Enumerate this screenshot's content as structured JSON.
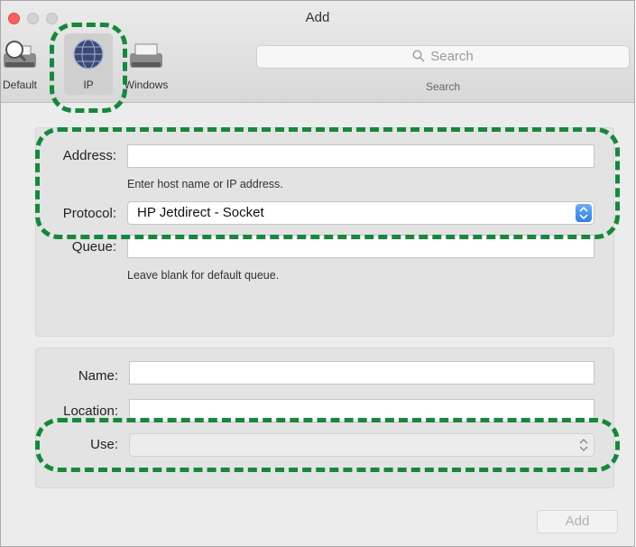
{
  "window": {
    "title": "Add"
  },
  "toolbar": {
    "items": [
      {
        "label": "Default"
      },
      {
        "label": "IP"
      },
      {
        "label": "Windows"
      }
    ],
    "search": {
      "placeholder": "Search",
      "label": "Search"
    }
  },
  "form": {
    "address": {
      "label": "Address:",
      "value": "",
      "hint": "Enter host name or IP address."
    },
    "protocol": {
      "label": "Protocol:",
      "value": "HP Jetdirect - Socket"
    },
    "queue": {
      "label": "Queue:",
      "value": "",
      "hint": "Leave blank for default queue."
    },
    "name": {
      "label": "Name:",
      "value": ""
    },
    "location": {
      "label": "Location:",
      "value": ""
    },
    "use": {
      "label": "Use:",
      "value": ""
    }
  },
  "actions": {
    "add_label": "Add"
  },
  "colors": {
    "highlight": "#138a3a",
    "close": "#fc605c",
    "accent": "#2a7ef0"
  }
}
